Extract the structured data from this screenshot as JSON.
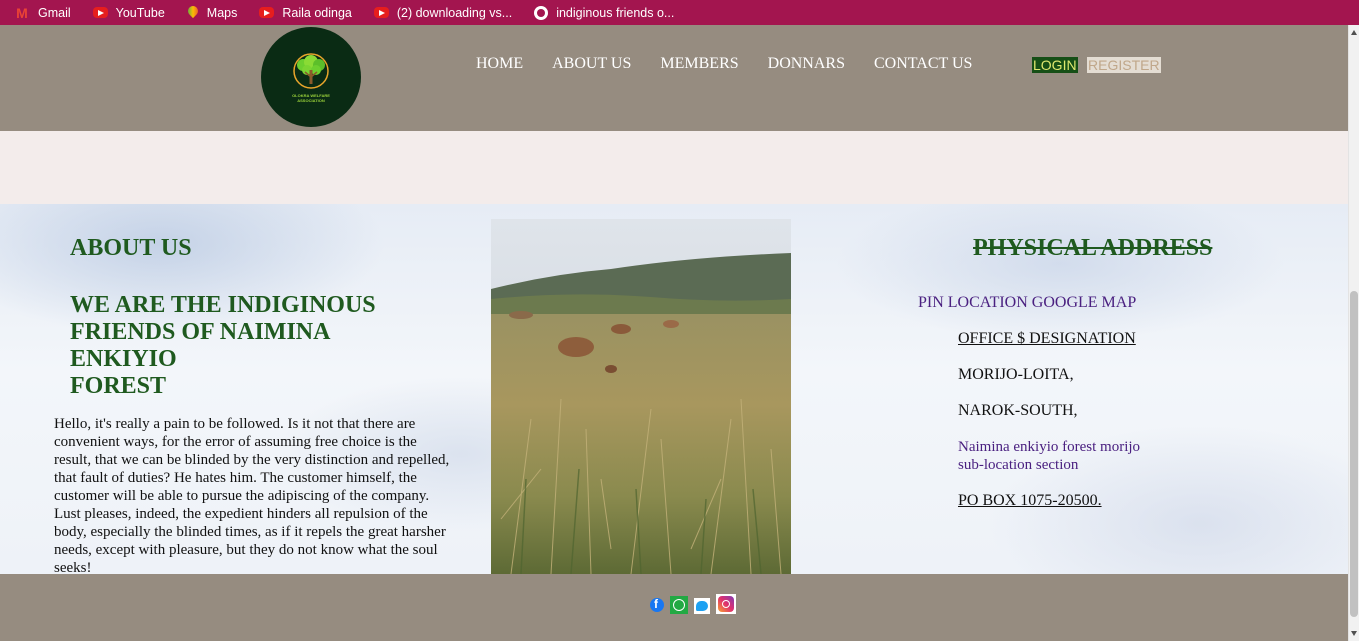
{
  "bookmarks": [
    {
      "label": "Gmail",
      "icon": "gmail-icon"
    },
    {
      "label": "YouTube",
      "icon": "youtube-icon"
    },
    {
      "label": "Maps",
      "icon": "maps-icon"
    },
    {
      "label": "Raila odinga",
      "icon": "youtube-icon"
    },
    {
      "label": "(2) downloading vs...",
      "icon": "youtube-icon"
    },
    {
      "label": "indiginous friends o...",
      "icon": "globe-icon"
    }
  ],
  "header": {
    "logo_text": "OLOKRA WELFARE ASSOCIATION",
    "nav": [
      "HOME",
      "ABOUT US",
      "MEMBERS",
      "DONNARS",
      "CONTACT US"
    ],
    "login_label": "LOGIN",
    "register_label": "REGISTER"
  },
  "about": {
    "title": "ABOUT US",
    "heading_lines": [
      "WE ARE THE INDIGINOUS",
      "FRIENDS OF NAIMINA",
      "ENKIYIO",
      "FOREST"
    ],
    "body": "Hello, it's really a pain to be followed. Is it not that there are convenient ways, for the error of assuming free choice is the result, that we can be blinded by the very distinction and repelled, that fault of duties? He hates him. The customer himself, the customer will be able to pursue the adipiscing of the company. Lust pleases, indeed, the expedient hinders all repulsion of the body, especially the blinded times, as if it repels the great harsher needs, except with pleasure, but they do not know what the soul seeks!"
  },
  "address": {
    "title": "PHYSICAL ADDRESS",
    "pin_link": "PIN LOCATION GOOGLE MAP",
    "office": "OFFICE $ DESIGNATION",
    "line1": "MORIJO-LOITA,",
    "line2": "NAROK-SOUTH,",
    "forest": "Naimina enkiyio forest morijo sub-location section",
    "pobox": "PO BOX 1075-20500."
  },
  "footer": {
    "social": [
      "facebook-icon",
      "whatsapp-icon",
      "twitter-icon",
      "instagram-icon"
    ]
  },
  "colors": {
    "bookmark_bar": "#a3154f",
    "header_bg": "#968c80",
    "heading_green": "#1f5a1f",
    "link_purple": "#4a2080"
  }
}
